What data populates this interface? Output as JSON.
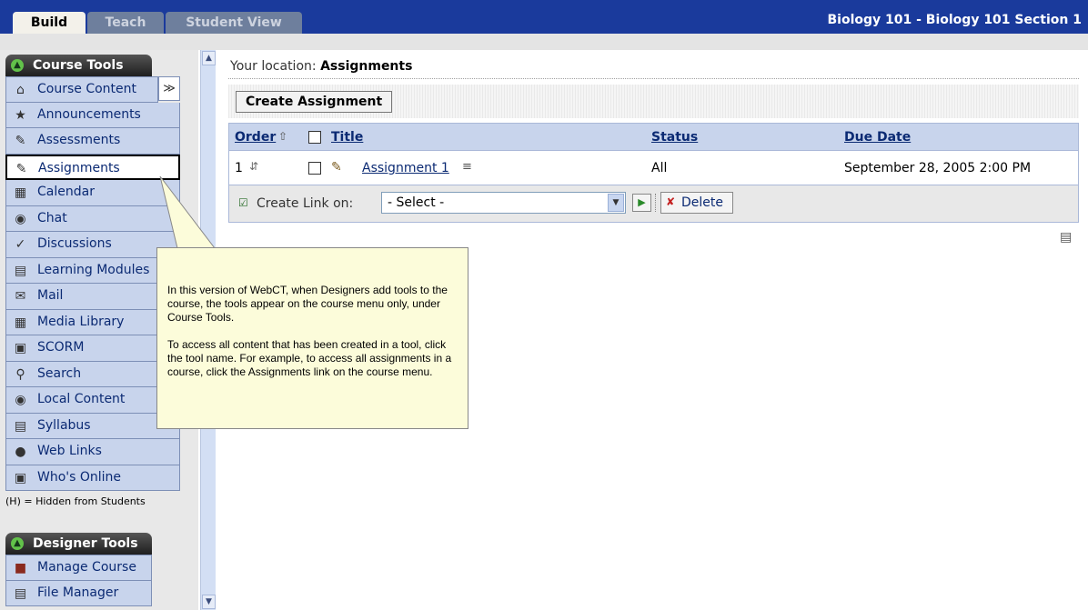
{
  "topbar": {
    "tabs": [
      {
        "label": "Build"
      },
      {
        "label": "Teach"
      },
      {
        "label": "Student View"
      }
    ],
    "course_title": "Biology 101 - Biology 101 Section 1"
  },
  "sidebar": {
    "course_tools_title": "Course Tools",
    "items": [
      {
        "label": "Course Content",
        "icon": "house-icon"
      },
      {
        "label": "Announcements",
        "icon": "megaphone-icon"
      },
      {
        "label": "Assessments",
        "icon": "assessment-icon"
      },
      {
        "label": "Assignments",
        "icon": "assignment-icon"
      },
      {
        "label": "Calendar",
        "icon": "calendar-icon"
      },
      {
        "label": "Chat",
        "icon": "chat-icon"
      },
      {
        "label": "Discussions",
        "icon": "pin-icon"
      },
      {
        "label": "Learning Modules",
        "icon": "book-icon"
      },
      {
        "label": "Mail",
        "icon": "mail-icon"
      },
      {
        "label": "Media Library",
        "icon": "media-icon"
      },
      {
        "label": "SCORM",
        "icon": "scorm-icon"
      },
      {
        "label": "Search",
        "icon": "search-icon"
      },
      {
        "label": "Local Content",
        "icon": "disc-icon"
      },
      {
        "label": "Syllabus",
        "icon": "syllabus-icon"
      },
      {
        "label": "Web Links",
        "icon": "globe-icon"
      },
      {
        "label": "Who's Online",
        "icon": "person-icon"
      }
    ],
    "hidden_note": "(H) = Hidden from Students",
    "designer_tools_title": "Designer Tools",
    "designer_items": [
      {
        "label": "Manage Course",
        "icon": "toolbox-icon"
      },
      {
        "label": "File Manager",
        "icon": "folder-icon"
      }
    ]
  },
  "main": {
    "location_prefix": "Your location:",
    "location_value": "Assignments",
    "create_button": "Create Assignment",
    "table": {
      "headers": {
        "order": "Order",
        "title": "Title",
        "status": "Status",
        "due_date": "Due Date"
      },
      "rows": [
        {
          "order": "1",
          "title": "Assignment 1",
          "status": "All",
          "due_date": "September 28, 2005 2:00 PM"
        }
      ]
    },
    "footer": {
      "create_link_label": "Create Link on:",
      "select_value": "- Select -",
      "delete_label": "Delete"
    }
  },
  "callout": {
    "paragraph1": "In this version of WebCT, when Designers add tools to the course, the tools appear on the course menu only, under Course Tools.",
    "paragraph2": "To access all content that has been created in a tool, click the tool name. For example, to access all assignments in a course, click the Assignments link on the course menu."
  },
  "colors": {
    "topbar": "#1a3a9c",
    "menu_item_bg": "#c8d4ec",
    "link": "#0b2a73",
    "callout_bg": "#fcfcda"
  }
}
